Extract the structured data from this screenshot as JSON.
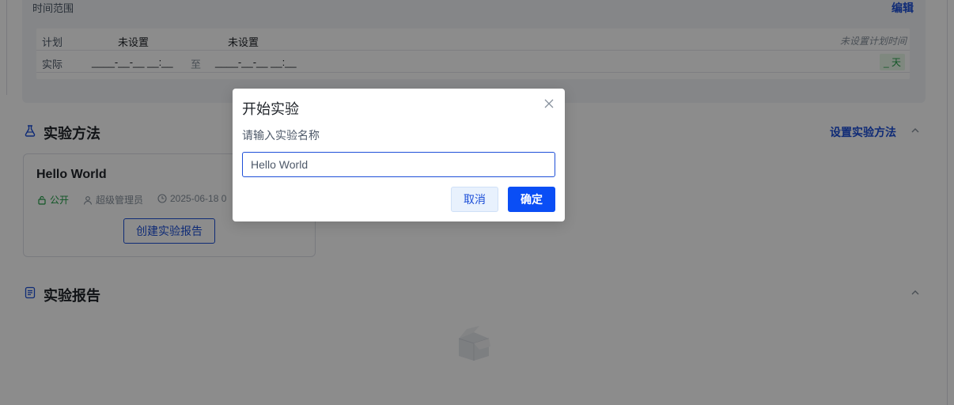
{
  "time_range": {
    "title": "时间范围",
    "edit_label": "编辑",
    "plan_label": "计划",
    "plan_start": "未设置",
    "plan_end": "未设置",
    "plan_hint": "未设置计划时间",
    "actual_label": "实际",
    "actual_start": "____-__-__ __:__",
    "to_label": "至",
    "actual_end": "____-__-__ __:__",
    "days": "_ 天"
  },
  "method_section": {
    "title": "实验方法",
    "set_link": "设置实验方法",
    "card": {
      "title": "Hello World",
      "visibility": "公开",
      "author": "超级管理员",
      "date": "2025-06-18 0",
      "create_button": "创建实验报告"
    }
  },
  "report_section": {
    "title": "实验报告"
  },
  "modal": {
    "title": "开始实验",
    "label": "请输入实验名称",
    "input_value": "Hello World",
    "cancel_label": "取消",
    "ok_label": "确定"
  },
  "colors": {
    "accent": "#1d4fd8",
    "primary_button": "#0a4ef5",
    "success": "#1f9d45",
    "overlay": "rgba(0,0,0,0.45)"
  },
  "icons": {
    "close": "close-icon",
    "method": "flask-icon",
    "report": "document-icon",
    "collapse": "chevron-up-icon",
    "lock": "lock-icon",
    "user": "user-icon",
    "clock": "clock-icon"
  }
}
